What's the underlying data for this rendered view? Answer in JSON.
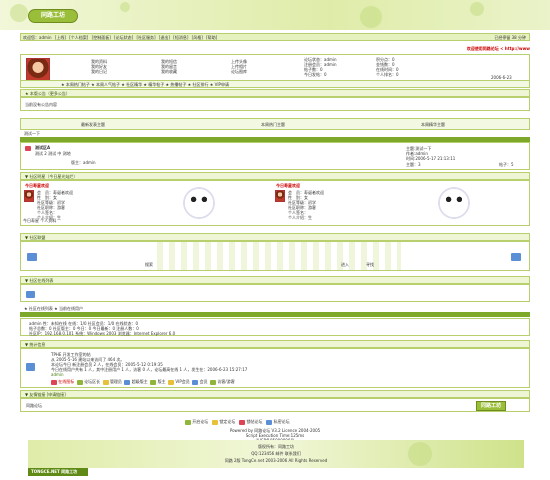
{
  "brand": {
    "logo": "同路工坊",
    "footer_logo": "TONGCE.NET 同路工坊"
  },
  "nav": {
    "items": [
      "欢迎您：admin",
      "[上线]",
      "[个人档案]",
      "[控制面板]",
      "[论坛状态]",
      "[社区服务]",
      "[退出]",
      "[短消息]",
      "[风格]",
      "[帮助]"
    ],
    "right": "已经停留 38 分钟"
  },
  "profile": {
    "col1": [
      "我的资料",
      "我的好友",
      "我的日记"
    ],
    "col2": [
      "我的短信",
      "我的留言",
      "我的收藏"
    ],
    "col3": [
      "上传头像",
      "上传相片",
      "论坛图库"
    ],
    "info": [
      "论坛状态：admin",
      "注册会员：admin",
      "帖子数：0",
      "今日发帖：0"
    ],
    "info2": [
      "积分点：0",
      "金钱数：0",
      "在线时间：0",
      "个人排名：0"
    ],
    "links": "★ 本周热门帖子 ★ 本周人气帖子 ★ 社区精华 ★ 精华帖子 ★ 热播帖子 ★ 社区排行 ★ VIP申请",
    "welcome": "欢迎使用同路论坛 < http://www",
    "date": "2006-6-23",
    "weekday": "星期五"
  },
  "notice": {
    "header": "★ 本版公告（更多公告）",
    "body": "当前没有公告内容"
  },
  "tabs": [
    "最新发表主题",
    "本周热门主题",
    "本周精华主题"
  ],
  "forum": {
    "section": "测试一下",
    "name": "测试区A",
    "desc": "测试 2 测试 中 测地",
    "moderator": "版主：admin",
    "topic": "主题:测试一下",
    "author": "作者:admin",
    "time": "时间:2006-5-17 21:13:11",
    "posts": "主题：3",
    "replies": "帖子：5"
  },
  "birthday": {
    "header": "▼ 社区明星（今日星光灿烂）",
    "today": "今日寿星欢迎",
    "fields": [
      "会　员：寿诞者欢迎",
      "性　别：女",
      "社区等级：初学",
      "社区职称：游客",
      "个人签名：",
      "个人介绍：生"
    ],
    "left_caption": "今日寿星 个人资料"
  },
  "links": {
    "header": "▼ 社区联盟",
    "search_label": "搜索",
    "go": "进入",
    "find": "寻找"
  },
  "online": {
    "header": "▼ 社区在线列表",
    "row1": "★ 社区在线列表 ★ 当前在线用户",
    "stats": [
      "admin  性：未知在线  在线：1/0  社区会员：1/0  在线状态：0",
      "帖子总数：0  社区版主：0  今日：0  今日最新：0  注册人数：0",
      "社区IP：192.168.0.101  系统：Windows 2003  浏览器：Internet Explorer 6.0"
    ]
  },
  "stats": {
    "header": "▼ 统计信息",
    "lines": [
      "TPHE 开发工作室的帖",
      "从 2005-5-16 建站以来访问了 464 次。",
      "本论坛今日 新注册会员 2 人，在线会员：2005-5-12 0:19:35",
      "今日在线用户共有 1 人，其中注册用户 1 人，访客 0 人，论坛最高在线 1 人，发生在：2006-6-23 15:27:17"
    ],
    "user": "admin",
    "legend": [
      "在线图标",
      "论坛区长",
      "管理员",
      "超级版主",
      "版主",
      "VIP会员",
      "会员",
      "访客/游客"
    ]
  },
  "link_exchange": {
    "header": "▼ 友情链接 [申请链接]",
    "item": "同路论坛",
    "logo": "同路工坊"
  },
  "legend_bar": [
    "开启论坛",
    "锁定论坛",
    "锁帖论坛",
    "私密论坛"
  ],
  "powered": {
    "line1": "Powered by 同路论坛 V3.2 Licence 2004-2005",
    "line2": "Script Execution Time:125ms",
    "line3": "浙ICP备05000000号"
  },
  "footer": {
    "links": "版权所有：同路工坊",
    "contact": "QQ:123456  邮件  联系我们",
    "copyright": "同路 2版 TongCe.net 2003-2006 All Rights Reserved"
  },
  "colors": {
    "accent": "#9bbe3a",
    "bar": "#7ea82a",
    "light": "#eef5d5",
    "border": "#b8cf6e"
  }
}
